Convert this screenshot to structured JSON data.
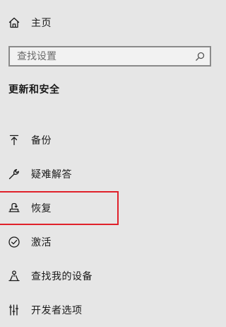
{
  "sidebar": {
    "home": {
      "label": "主页",
      "icon": "home-icon"
    },
    "search": {
      "placeholder": "查找设置",
      "value": "",
      "icon": "search-icon"
    },
    "section_title": "更新和安全",
    "items": [
      {
        "label": "备份",
        "icon": "backup-arrow-icon"
      },
      {
        "label": "疑难解答",
        "icon": "wrench-icon"
      },
      {
        "label": "恢复",
        "icon": "recovery-icon",
        "highlighted": true
      },
      {
        "label": "激活",
        "icon": "check-circle-icon"
      },
      {
        "label": "查找我的设备",
        "icon": "person-locate-icon"
      },
      {
        "label": "开发者选项",
        "icon": "developer-tools-icon"
      }
    ]
  },
  "colors": {
    "background": "#e6e6e6",
    "text": "#1a1a1a",
    "search_border": "#8a8a8a",
    "highlight_border": "#e0212b"
  }
}
